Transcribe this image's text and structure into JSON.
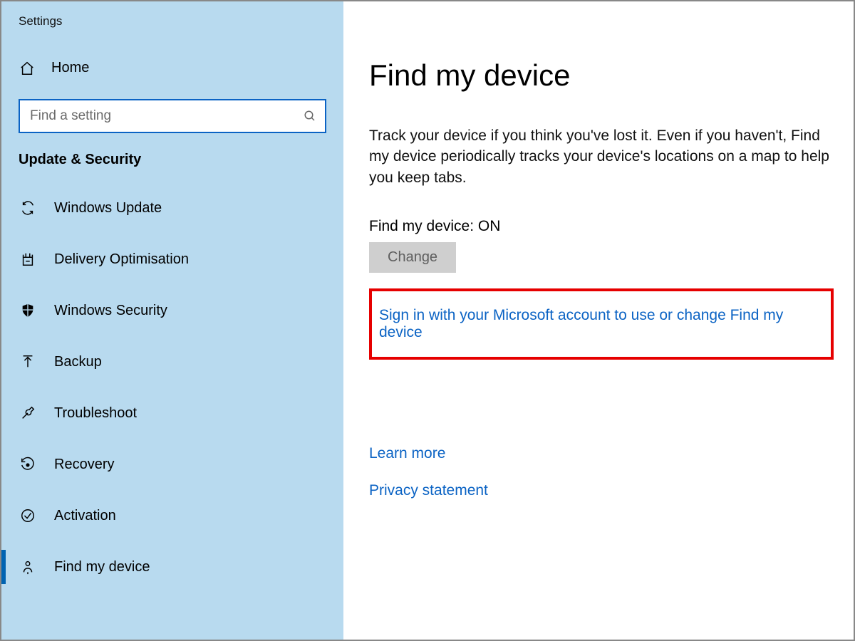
{
  "app_title": "Settings",
  "home_label": "Home",
  "search": {
    "placeholder": "Find a setting"
  },
  "section_title": "Update & Security",
  "nav": {
    "items": [
      {
        "label": "Windows Update"
      },
      {
        "label": "Delivery Optimisation"
      },
      {
        "label": "Windows Security"
      },
      {
        "label": "Backup"
      },
      {
        "label": "Troubleshoot"
      },
      {
        "label": "Recovery"
      },
      {
        "label": "Activation"
      },
      {
        "label": "Find my device"
      }
    ]
  },
  "main": {
    "heading": "Find my device",
    "description": "Track your device if you think you've lost it. Even if you haven't, Find my device periodically tracks your device's locations on a map to help you keep tabs.",
    "status_label": "Find my device: ON",
    "change_button": "Change",
    "signin_link": "Sign in with your Microsoft account to use or change Find my device",
    "learn_more": "Learn more",
    "privacy": "Privacy statement"
  }
}
